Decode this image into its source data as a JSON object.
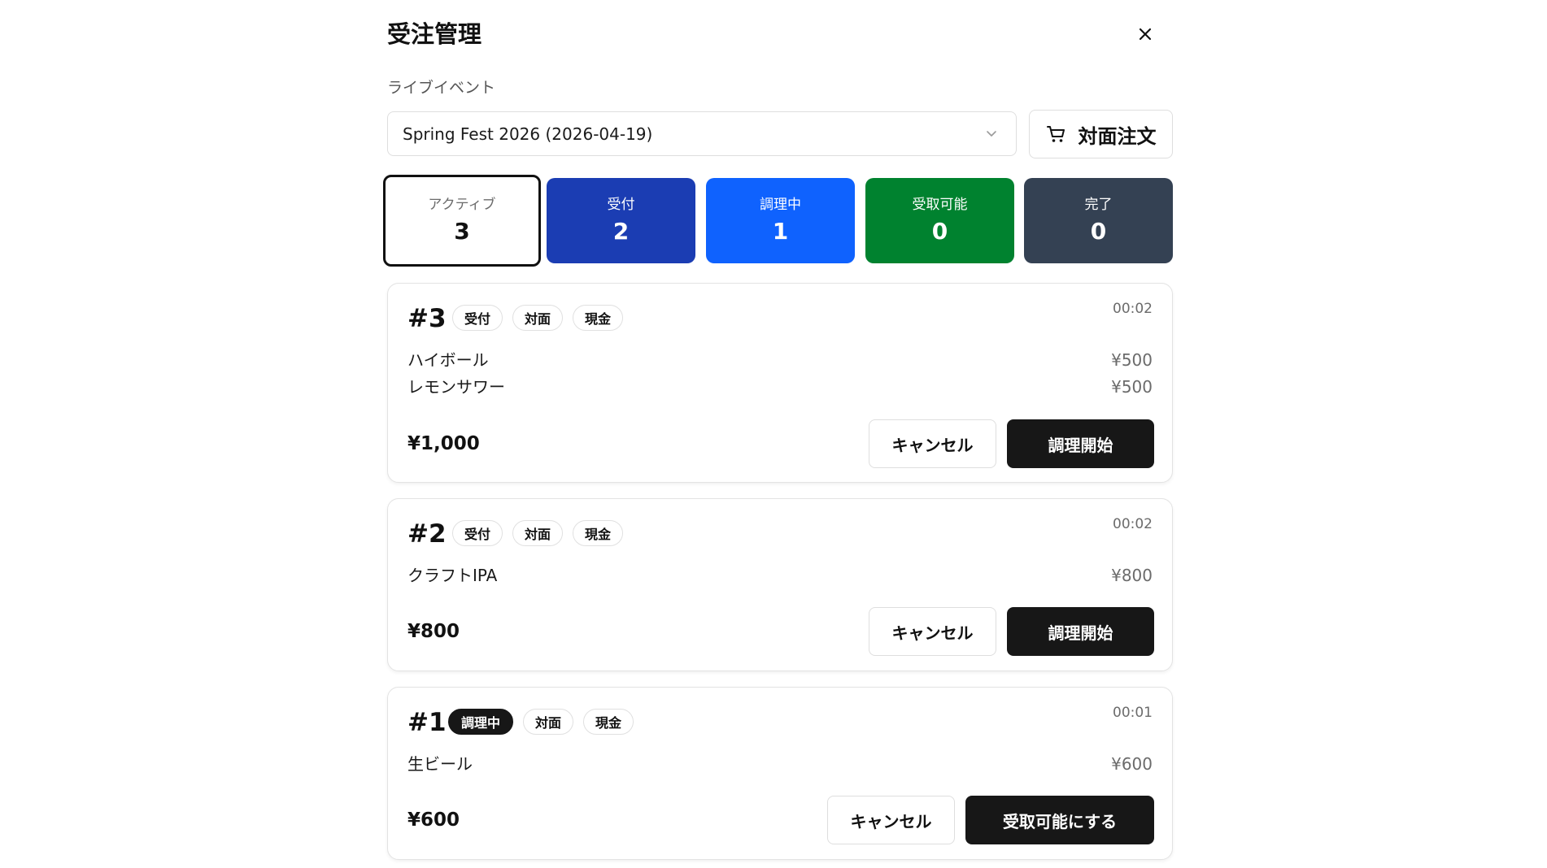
{
  "header": {
    "title": "受注管理"
  },
  "event": {
    "label": "ライブイベント",
    "selected": "Spring Fest 2026 (2026-04-19)"
  },
  "walkin_button": {
    "label": "対面注文"
  },
  "stats": [
    {
      "label": "アクティブ",
      "count": "3"
    },
    {
      "label": "受付",
      "count": "2",
      "color": "#1b3db3"
    },
    {
      "label": "調理中",
      "count": "1",
      "color": "#0f62fe"
    },
    {
      "label": "受取可能",
      "count": "0",
      "color": "#00822f"
    },
    {
      "label": "完了",
      "count": "0",
      "color": "#344153"
    }
  ],
  "orders": [
    {
      "number": "#3",
      "badges": [
        "受付",
        "対面",
        "現金"
      ],
      "time": "00:02",
      "items": [
        {
          "name": "ハイボール",
          "price": "¥500"
        },
        {
          "name": "レモンサワー",
          "price": "¥500"
        }
      ],
      "total": "¥1,000",
      "cancel_label": "キャンセル",
      "action_label": "調理開始"
    },
    {
      "number": "#2",
      "badges": [
        "受付",
        "対面",
        "現金"
      ],
      "time": "00:02",
      "items": [
        {
          "name": "クラフトIPA",
          "price": "¥800"
        }
      ],
      "total": "¥800",
      "cancel_label": "キャンセル",
      "action_label": "調理開始"
    },
    {
      "number": "#1",
      "badges": [
        "調理中",
        "対面",
        "現金"
      ],
      "time": "00:01",
      "items": [
        {
          "name": "生ビール",
          "price": "¥600"
        }
      ],
      "total": "¥600",
      "cancel_label": "キャンセル",
      "action_label": "受取可能にする"
    }
  ]
}
